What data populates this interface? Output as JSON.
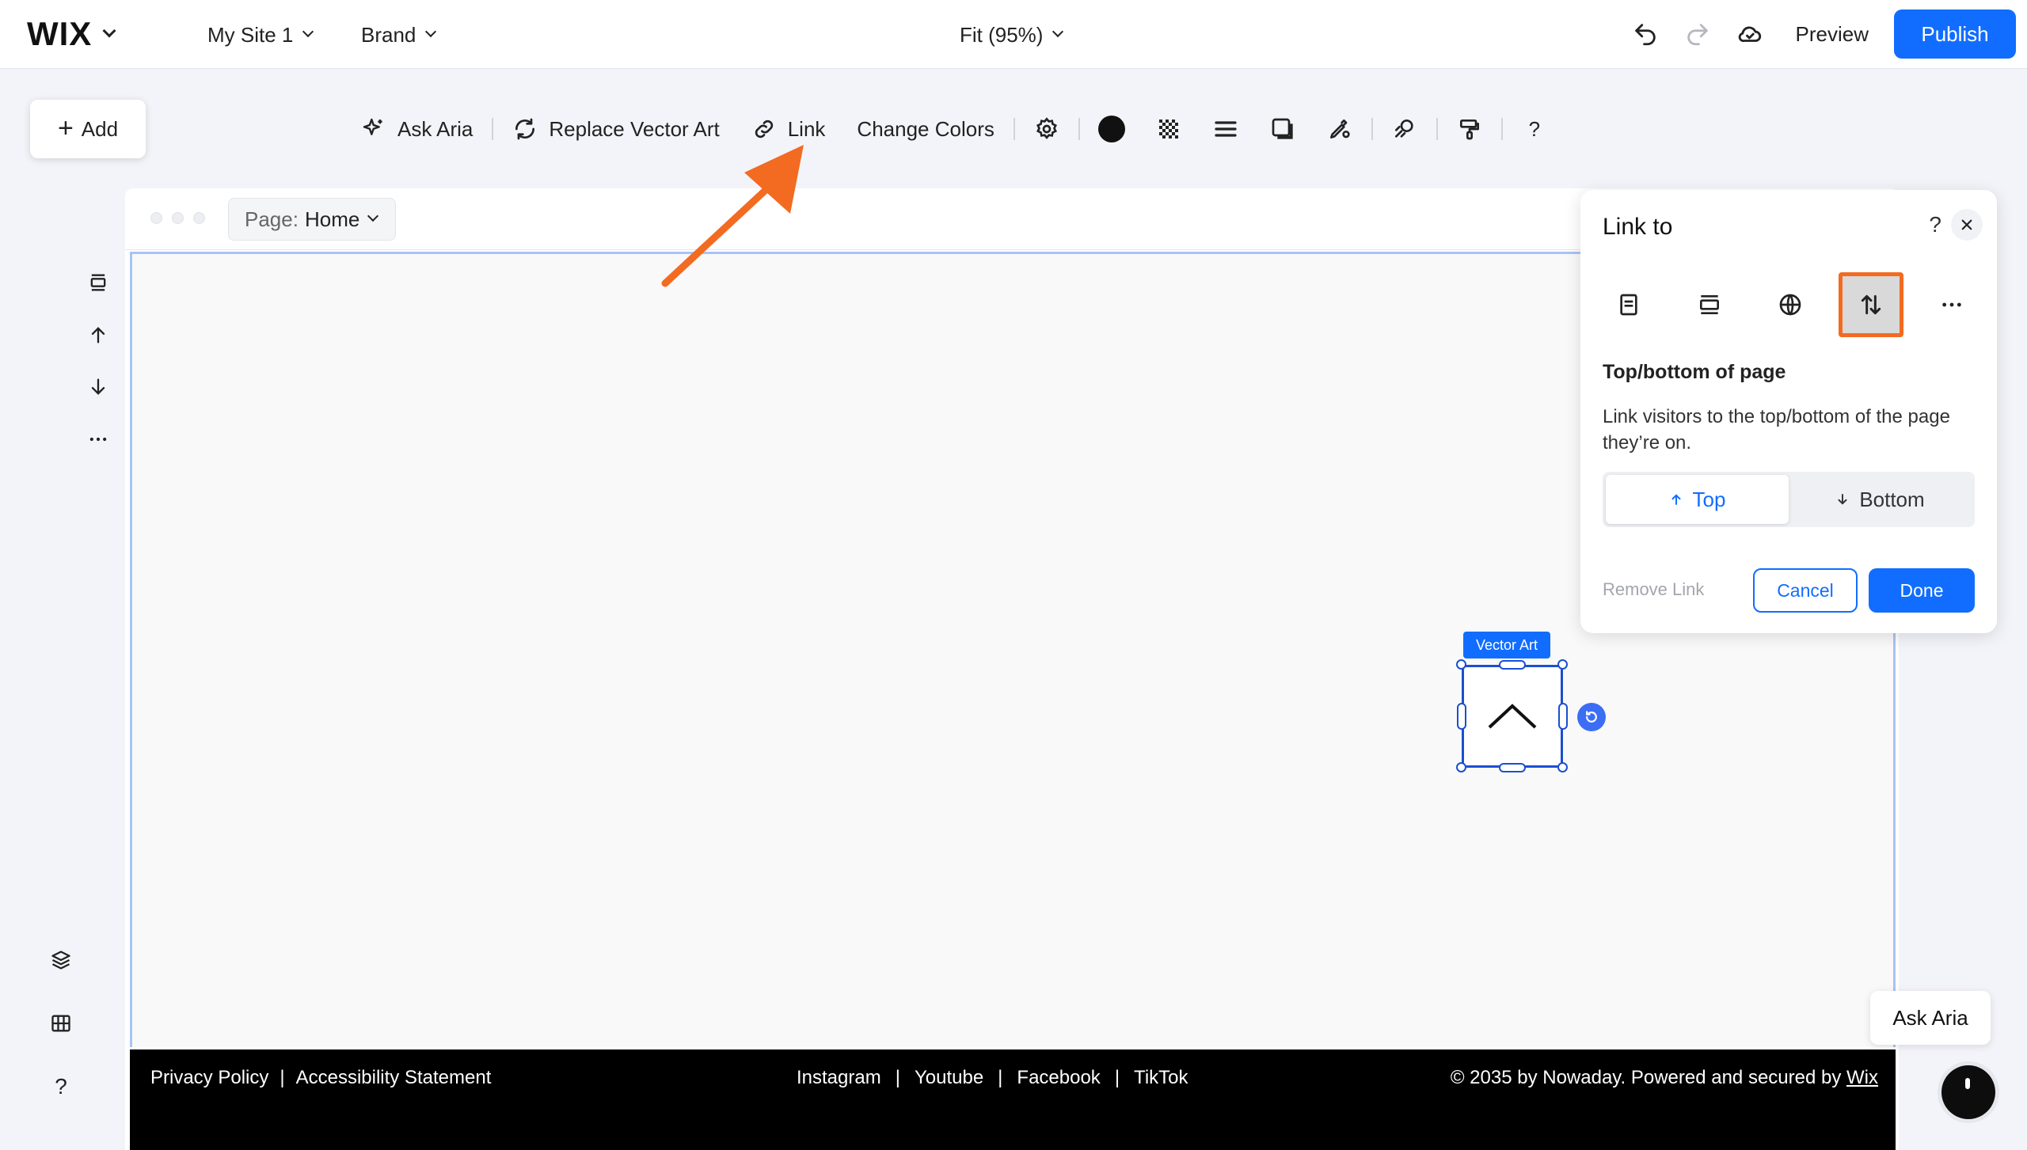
{
  "topbar": {
    "logo": "WIX",
    "site_name": "My Site 1",
    "brand": "Brand",
    "zoom": "Fit (95%)",
    "preview": "Preview",
    "publish": "Publish"
  },
  "add_button": {
    "label": "Add"
  },
  "toolbar": {
    "ask_aria": "Ask Aria",
    "replace_vector_art": "Replace Vector Art",
    "link": "Link",
    "change_colors": "Change Colors",
    "help": "?"
  },
  "canvas": {
    "page_label": "Page:",
    "page_value": "Home"
  },
  "footer": {
    "left_links": [
      "Privacy Policy",
      "Accessibility Statement"
    ],
    "social_links": [
      "Instagram",
      "Youtube",
      "Facebook",
      "TikTok"
    ],
    "copyright": "© 2035 by Nowaday. Powered and secured by ",
    "wix_link": "Wix"
  },
  "vector_art": {
    "tag": "Vector Art"
  },
  "link_panel": {
    "title": "Link to",
    "help": "?",
    "tabs": [
      {
        "icon": "page-icon",
        "active": false
      },
      {
        "icon": "section-anchor-icon",
        "active": false
      },
      {
        "icon": "globe-icon",
        "active": false
      },
      {
        "icon": "top-bottom-arrows-icon",
        "active": true
      },
      {
        "icon": "more-icon",
        "active": false
      }
    ],
    "subtitle": "Top/bottom of page",
    "description": "Link visitors to the top/bottom of the page they’re on.",
    "segment_top": "Top",
    "segment_bottom": "Bottom",
    "segment_selected": "Top",
    "remove_link": "Remove Link",
    "cancel": "Cancel",
    "done": "Done"
  },
  "ask_aria_float": {
    "label": "Ask Aria"
  },
  "colors": {
    "accent": "#116dff",
    "highlight": "#f26b21",
    "footer_bg": "#000000"
  }
}
